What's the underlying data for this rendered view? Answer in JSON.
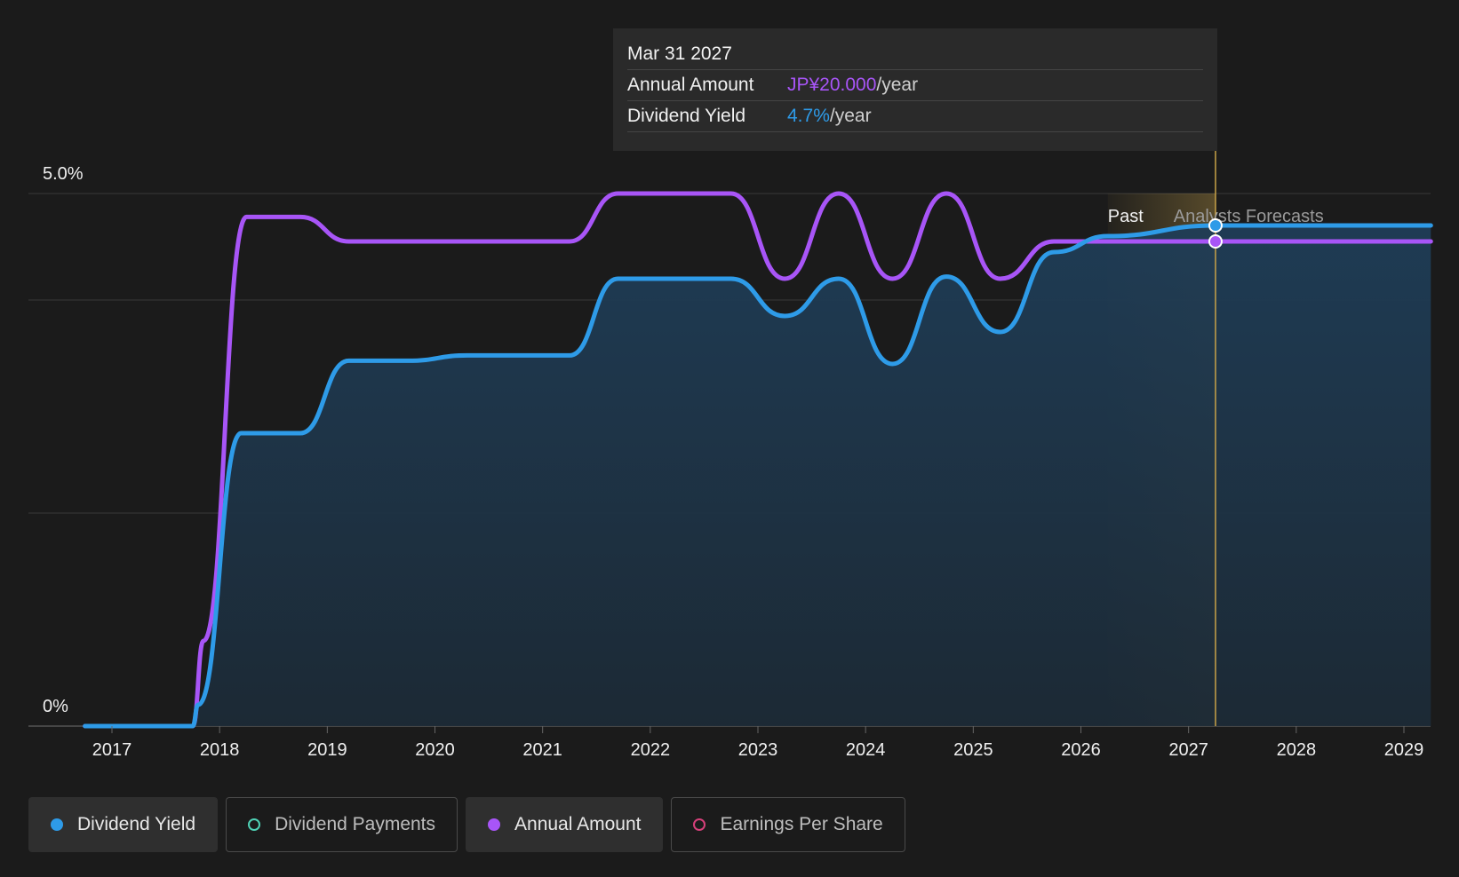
{
  "tooltip": {
    "date": "Mar 31 2027",
    "rows": [
      {
        "label": "Annual Amount",
        "value": "JP¥20.000",
        "unit": "/year"
      },
      {
        "label": "Dividend Yield",
        "value": "4.7%",
        "unit": "/year"
      }
    ]
  },
  "legend": {
    "items": [
      {
        "label": "Dividend Yield",
        "color": "#2e9be8",
        "active": true
      },
      {
        "label": "Dividend Payments",
        "color": "#4fd1b5",
        "active": false
      },
      {
        "label": "Annual Amount",
        "color": "#a855f7",
        "active": true
      },
      {
        "label": "Earnings Per Share",
        "color": "#d6407a",
        "active": false
      }
    ]
  },
  "chart_data": {
    "type": "line",
    "x_ticks": [
      "2017",
      "2018",
      "2019",
      "2020",
      "2021",
      "2022",
      "2023",
      "2024",
      "2025",
      "2026",
      "2027",
      "2028",
      "2029"
    ],
    "xlim": [
      2016.75,
      2029.25
    ],
    "ylim": [
      0,
      5
    ],
    "y_tick_labels": [
      {
        "value": 5,
        "label": "5.0%"
      },
      {
        "value": 0,
        "label": "0%"
      }
    ],
    "gridlines": [
      5,
      4,
      2,
      0
    ],
    "region_labels": {
      "past": "Past",
      "forecast": "Analysts Forecasts"
    },
    "forecast_start": 2026.25,
    "highlight_x": 2027.25,
    "colors": {
      "yield": "#2e9be8",
      "amount": "#a855f7",
      "background": "#1b1b1b",
      "grid": "#3a3a3a",
      "highlight": "#c8a248"
    },
    "series": [
      {
        "name": "Dividend Yield",
        "key": "yield",
        "points": [
          [
            2016.75,
            0
          ],
          [
            2017.75,
            0
          ],
          [
            2017.8,
            0.2
          ],
          [
            2018.2,
            2.75
          ],
          [
            2018.75,
            2.75
          ],
          [
            2019.2,
            3.43
          ],
          [
            2019.75,
            3.43
          ],
          [
            2020.3,
            3.48
          ],
          [
            2021.25,
            3.48
          ],
          [
            2021.7,
            4.2
          ],
          [
            2022.75,
            4.2
          ],
          [
            2023.25,
            3.85
          ],
          [
            2023.75,
            4.2
          ],
          [
            2024.25,
            3.4
          ],
          [
            2024.75,
            4.22
          ],
          [
            2025.25,
            3.7
          ],
          [
            2025.75,
            4.45
          ],
          [
            2026.25,
            4.6
          ],
          [
            2027.25,
            4.7
          ],
          [
            2029.25,
            4.7
          ]
        ]
      },
      {
        "name": "Annual Amount",
        "key": "amount",
        "points": [
          [
            2016.75,
            0
          ],
          [
            2017.75,
            0
          ],
          [
            2017.85,
            0.8
          ],
          [
            2018.25,
            4.78
          ],
          [
            2018.75,
            4.78
          ],
          [
            2019.2,
            4.55
          ],
          [
            2021.25,
            4.55
          ],
          [
            2021.7,
            5.0
          ],
          [
            2022.75,
            5.0
          ],
          [
            2023.25,
            4.2
          ],
          [
            2023.75,
            5.0
          ],
          [
            2024.25,
            4.2
          ],
          [
            2024.75,
            5.0
          ],
          [
            2025.25,
            4.2
          ],
          [
            2025.75,
            4.55
          ],
          [
            2029.25,
            4.55
          ]
        ]
      }
    ],
    "markers": [
      {
        "series": "yield",
        "x": 2027.25,
        "y": 4.7
      },
      {
        "series": "amount",
        "x": 2027.25,
        "y": 4.55
      }
    ]
  }
}
